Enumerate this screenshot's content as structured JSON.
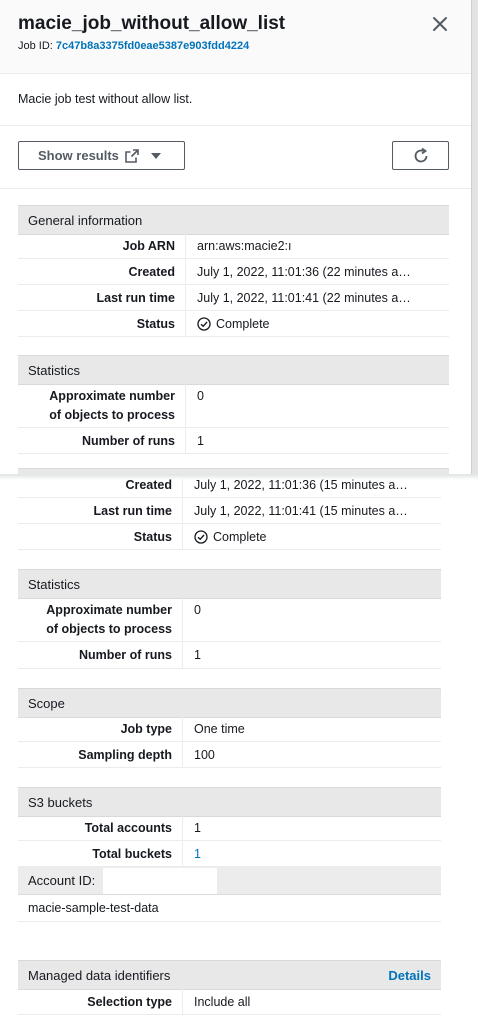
{
  "header": {
    "title": "macie_job_without_allow_list",
    "job_id_label": "Job ID:",
    "job_id_value": "7c47b8a3375fd0eae5387e903fdd4224",
    "description": "Macie job test without allow list."
  },
  "toolbar": {
    "show_results_label": "Show results"
  },
  "panel_top": {
    "general": {
      "title": "General information",
      "rows": [
        {
          "label": "Job ARN",
          "value": "arn:aws:macie2:ı"
        },
        {
          "label": "Created",
          "value": "July 1, 2022, 11:01:36 (22 minutes a…"
        },
        {
          "label": "Last run time",
          "value": "July 1, 2022, 11:01:41 (22 minutes a…"
        },
        {
          "label": "Status",
          "value": "Complete"
        }
      ]
    },
    "statistics": {
      "title": "Statistics",
      "approx_label_1": "Approximate number",
      "approx_label_2": "of objects to process",
      "approx_value": "0",
      "runs_label": "Number of runs",
      "runs_value": "1"
    }
  },
  "panel_bottom": {
    "general_partial": {
      "rows": [
        {
          "label": "Created",
          "value": "July 1, 2022, 11:01:36 (15 minutes a…"
        },
        {
          "label": "Last run time",
          "value": "July 1, 2022, 11:01:41 (15 minutes a…"
        },
        {
          "label": "Status",
          "value": "Complete"
        }
      ]
    },
    "statistics": {
      "title": "Statistics",
      "approx_label_1": "Approximate number",
      "approx_label_2": "of objects to process",
      "approx_value": "0",
      "runs_label": "Number of runs",
      "runs_value": "1"
    },
    "scope": {
      "title": "Scope",
      "job_type_label": "Job type",
      "job_type_value": "One time",
      "sampling_label": "Sampling depth",
      "sampling_value": "100"
    },
    "s3": {
      "title": "S3 buckets",
      "total_accounts_label": "Total accounts",
      "total_accounts_value": "1",
      "total_buckets_label": "Total buckets",
      "total_buckets_value": "1",
      "account_id_label": "Account ID:",
      "bucket_name": "macie-sample-test-data"
    },
    "managed": {
      "title": "Managed data identifiers",
      "details_label": "Details",
      "selection_label": "Selection type",
      "selection_value": "Include all"
    }
  },
  "colors": {
    "link": "#0073bb",
    "section_bg": "#e8e8e8",
    "text": "#16191f"
  },
  "icons": [
    "close-icon",
    "external-link-icon",
    "caret-down-icon",
    "refresh-icon",
    "status-complete-icon"
  ]
}
